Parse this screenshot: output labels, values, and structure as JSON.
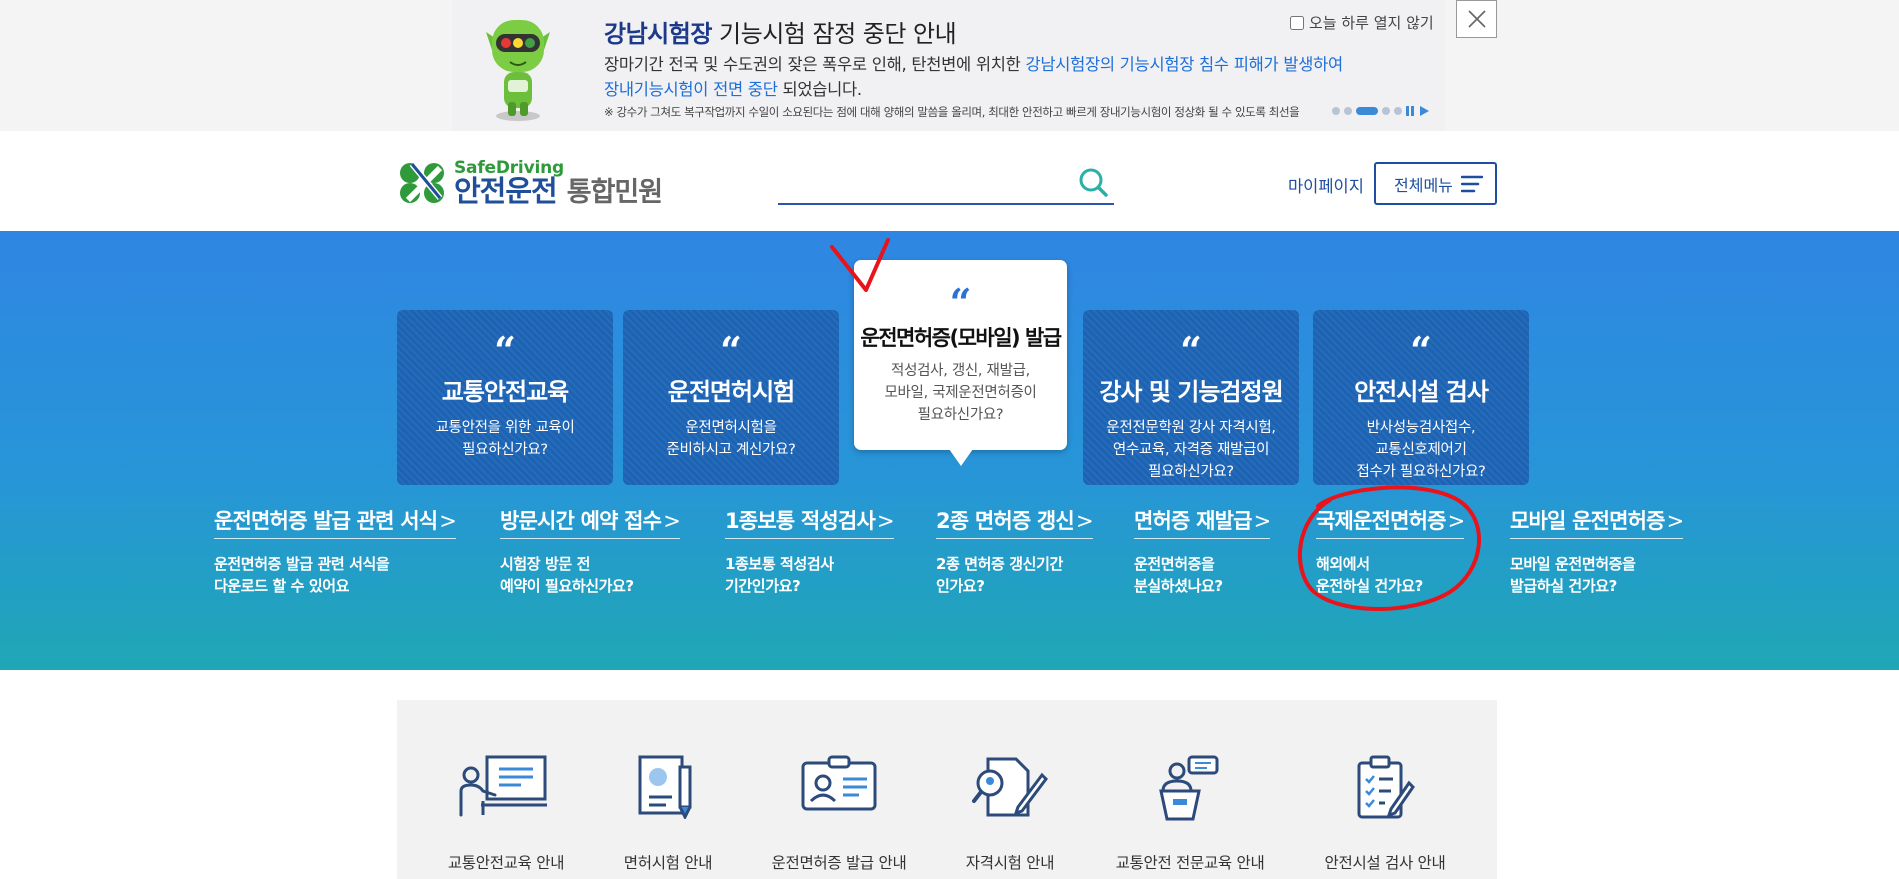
{
  "notice": {
    "title_highlight": "강남시험장",
    "title_rest": " 기능시험 잠정 중단 안내",
    "body_line1_a": "장마기간 전국 및 수도권의 잦은 폭우로 인해, 탄천변에 위치한 ",
    "body_line1_b": "강남시험장의 기능시험장 침수 피해가 발생하여",
    "body_line2_a": "장내기능시험이 전면 중단",
    "body_line2_b": " 되었습니다.",
    "note": "※ 강수가 그쳐도 복구작업까지 수일이 소요된다는 점에 대해 양해의 말씀을 올리며, 최대한 안전하고 빠르게 장내기능시험이 정상화 될 수 있도록 최선을",
    "dont_show_label": "오늘 하루 열지 않기",
    "close_icon": "close-icon"
  },
  "header": {
    "logo_safe": "SafeDriving",
    "logo_main": "안전운전",
    "logo_sub": "통합민원",
    "search_placeholder": "",
    "mypage": "마이페이지",
    "all_menu": "전체메뉴"
  },
  "cards": [
    {
      "quote": "“",
      "title": "교통안전교육",
      "desc": "교통안전을 위한 교육이\n필요하신가요?"
    },
    {
      "quote": "“",
      "title": "운전면허시험",
      "desc": "운전면허시험을\n준비하시고 계신가요?"
    },
    {
      "quote": "“",
      "title": "운전면허증(모바일) 발급",
      "desc": "적성검사, 갱신, 재발급,\n모바일, 국제운전면허증이\n필요하신가요?"
    },
    {
      "quote": "“",
      "title": "강사 및 기능검정원",
      "desc": "운전전문학원 강사 자격시험,\n연수교육, 자격증 재발급이\n필요하신가요?"
    },
    {
      "quote": "“",
      "title": "안전시설 검사",
      "desc": "반사성능검사접수,\n교통신호제어기\n접수가 필요하신가요?"
    }
  ],
  "links": [
    {
      "title": "운전면허증 발급 관련 서식",
      "desc": "운전면허증 발급 관련 서식을\n다운로드 할 수 있어요"
    },
    {
      "title": "방문시간 예약 접수",
      "desc": "시험장 방문 전\n예약이 필요하신가요?"
    },
    {
      "title": "1종보통 적성검사",
      "desc": "1종보통 적성검사\n기간인가요?"
    },
    {
      "title": "2종 면허증 갱신",
      "desc": "2종 면허증 갱신기간\n인가요?"
    },
    {
      "title": "면허증 재발급",
      "desc": "운전면허증을\n분실하셨나요?"
    },
    {
      "title": "국제운전면허증",
      "desc": "해외에서\n운전하실 건가요?"
    },
    {
      "title": "모바일 운전면허증",
      "desc": "모바일 운전면허증을\n발급하실 건가요?"
    }
  ],
  "link_chevron": ">",
  "services": [
    {
      "label": "교통안전교육 안내",
      "icon": "presentation-icon"
    },
    {
      "label": "면허시험 안내",
      "icon": "exam-document-icon"
    },
    {
      "label": "운전면허증 발급 안내",
      "icon": "license-card-icon"
    },
    {
      "label": "자격시험 안내",
      "icon": "qualification-search-icon"
    },
    {
      "label": "교통안전 전문교육 안내",
      "icon": "lecture-podium-icon"
    },
    {
      "label": "안전시설 검사 안내",
      "icon": "checklist-clipboard-icon"
    }
  ],
  "colors": {
    "hero_top": "#2f86e2",
    "hero_bottom": "#1fa7b5",
    "card": "#1c63b4",
    "brand_blue": "#1e4ea0",
    "logo_green": "#2e9a3a",
    "annotation_red": "#e8141c"
  }
}
